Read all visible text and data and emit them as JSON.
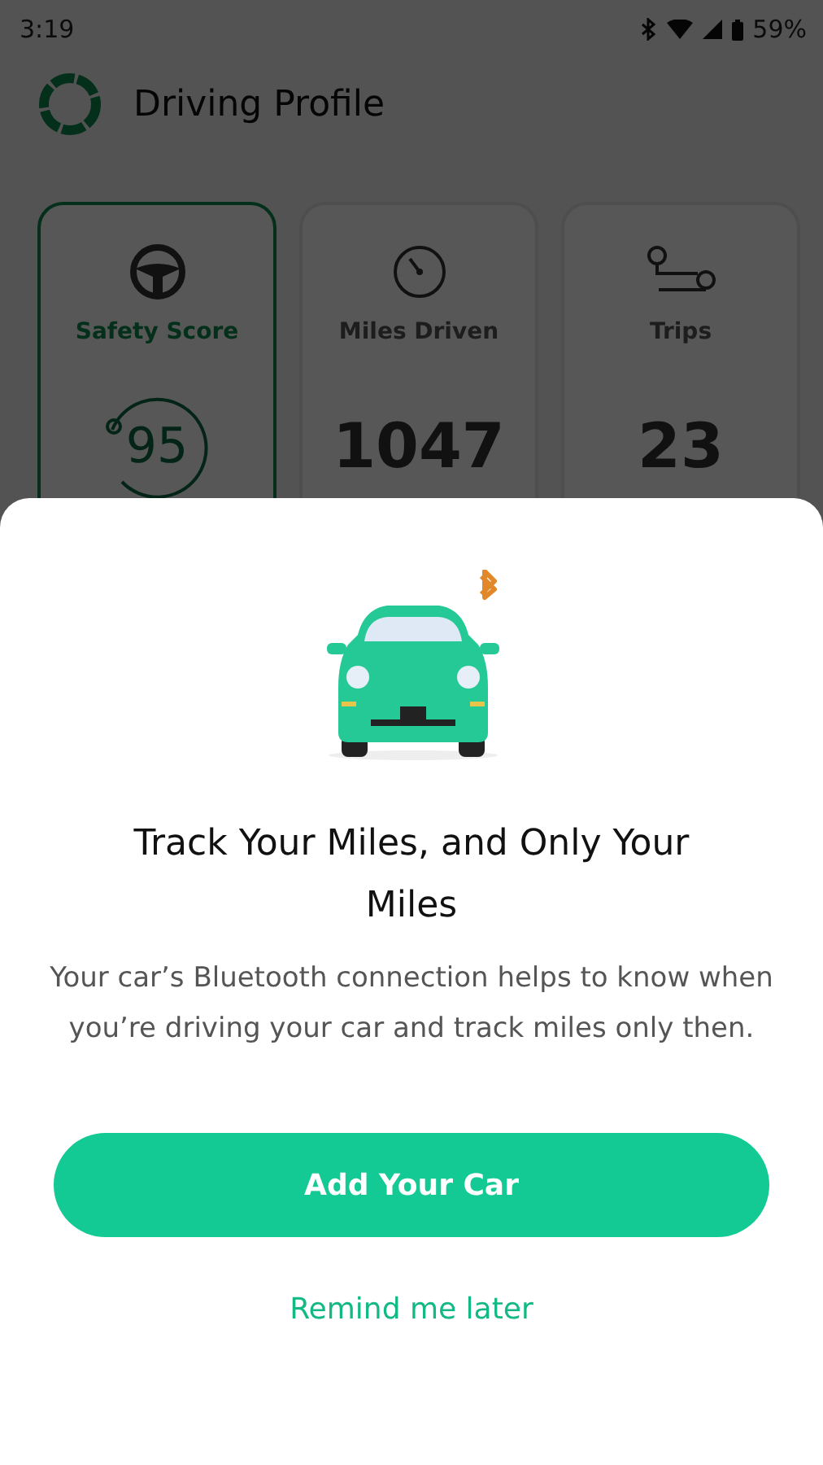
{
  "status_bar": {
    "time": "3:19",
    "battery": "59%"
  },
  "header": {
    "title": "Driving Profile"
  },
  "cards": [
    {
      "kind": "score",
      "label": "Safety Score",
      "value": "95",
      "selected": true
    },
    {
      "kind": "miles",
      "label": "Miles Driven",
      "value": "1047",
      "selected": false
    },
    {
      "kind": "trips",
      "label": "Trips",
      "value": "23",
      "selected": false
    }
  ],
  "sheet": {
    "title": "Track Your Miles, and Only Your Miles",
    "body": "Your car’s Bluetooth connection helps to know when you’re driving your car and track miles only then.",
    "primary_button": "Add Your Car",
    "secondary_link": "Remind me later"
  }
}
